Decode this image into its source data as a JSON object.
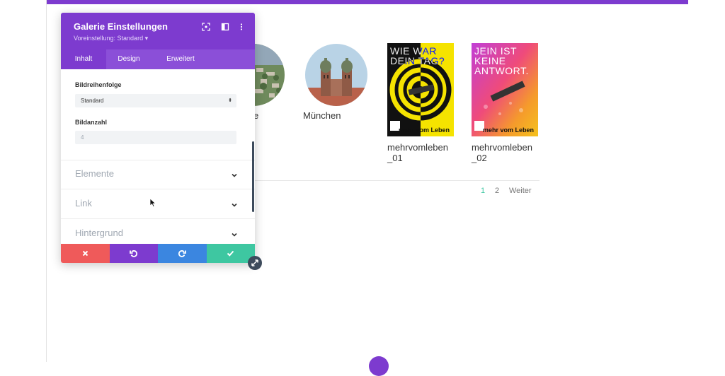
{
  "panel": {
    "title": "Galerie Einstellungen",
    "preset": "Voreinstellung: Standard ▾",
    "tabs": [
      {
        "label": "Inhalt",
        "active": true
      },
      {
        "label": "Design",
        "active": false
      },
      {
        "label": "Erweitert",
        "active": false
      }
    ],
    "fields": {
      "order_label": "Bildreihenfolge",
      "order_value": "Standard",
      "count_label": "Bildanzahl",
      "count_value": "4"
    },
    "sections": [
      "Elemente",
      "Link",
      "Hintergrund"
    ],
    "icons": [
      "focus-icon",
      "layout-icon",
      "more-icon",
      "chevron-down-icon",
      "close-icon",
      "undo-icon",
      "redo-icon",
      "check-icon",
      "resize-icon"
    ]
  },
  "gallery": {
    "items": [
      {
        "caption": "e"
      },
      {
        "caption": "München"
      },
      {
        "caption": "mehrvomleben\n_01",
        "poster_text": "WIE WAR DEIN TAG?",
        "brand": "mehr vom Leben"
      },
      {
        "caption": "mehrvomleben\n_02",
        "poster_text": "JEIN IST KEINE ANTWORT.",
        "brand": "mehr vom Leben"
      }
    ],
    "pagination": {
      "pages": [
        "1",
        "2"
      ],
      "current": "1",
      "next": "Weiter"
    }
  },
  "colors": {
    "accent": "#7d3bcf",
    "cancel": "#ef5a5a",
    "undo": "#7d3bcf",
    "redo": "#3b86e0",
    "save": "#3ec7a1"
  }
}
